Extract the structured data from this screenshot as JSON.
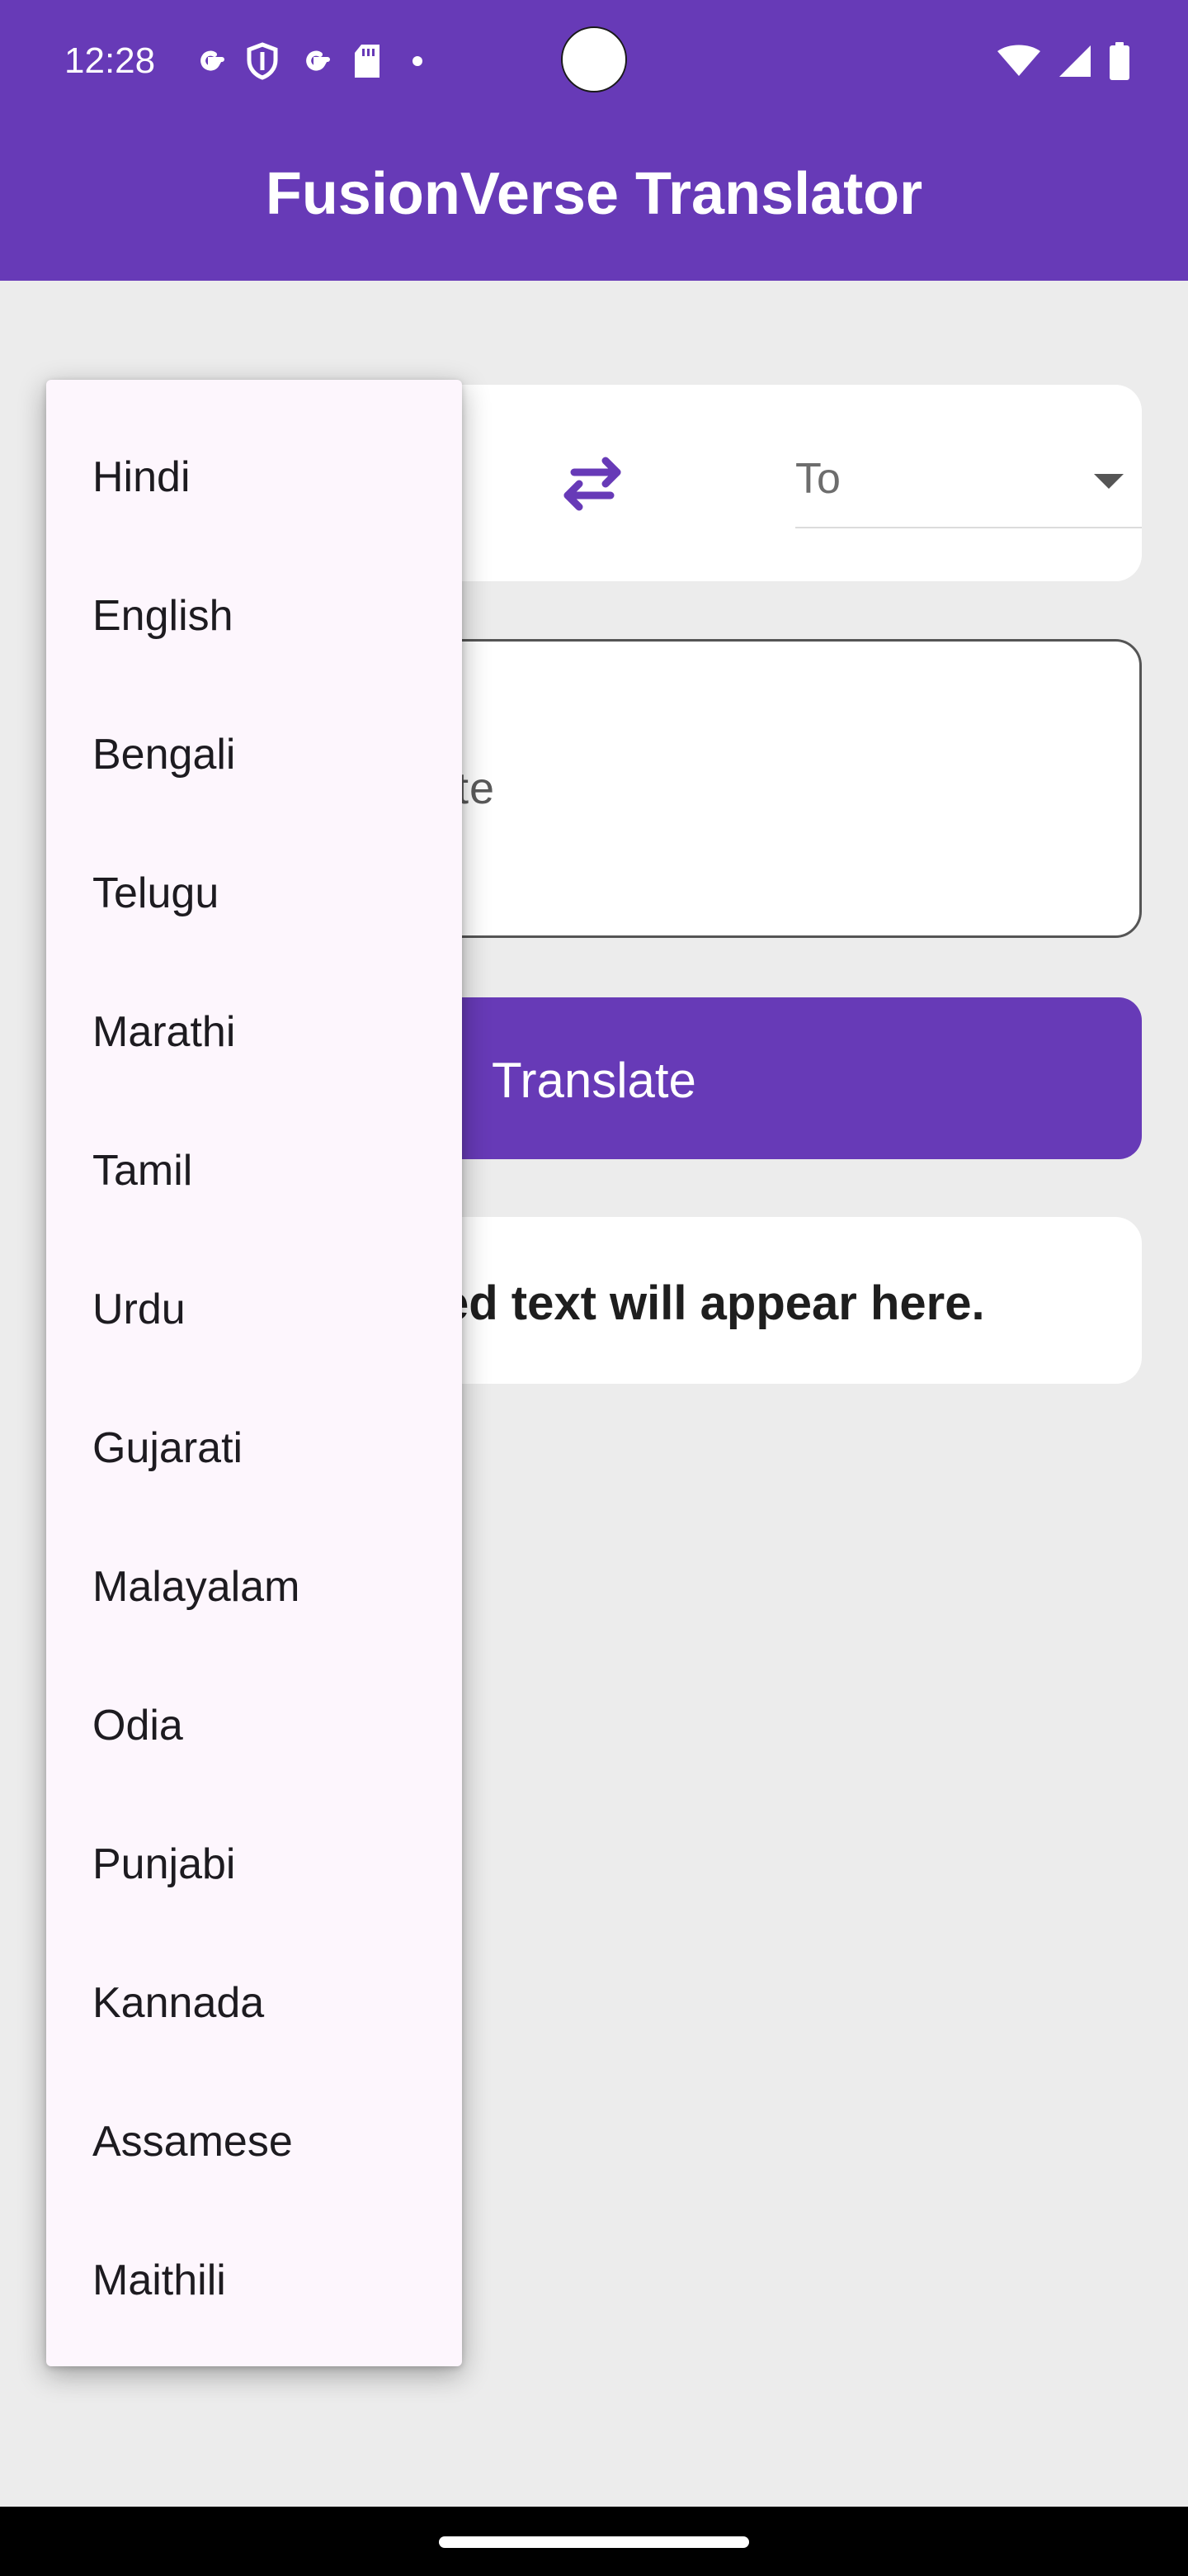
{
  "status_bar": {
    "time": "12:28",
    "left_icons": [
      "google-g-icon",
      "shield-icon",
      "google-g-icon",
      "sd-card-icon",
      "dot-icon"
    ],
    "right_icons": [
      "wifi-icon",
      "signal-icon",
      "battery-icon"
    ]
  },
  "app_bar": {
    "title": "FusionVerse Translator"
  },
  "language_selector": {
    "swap_icon": "swap-arrows-icon",
    "to_label": "To"
  },
  "input": {
    "placeholder_visible": "slate"
  },
  "translate_button": {
    "label": "Translate"
  },
  "output": {
    "visible_text": "ed text will appear here."
  },
  "dropdown": {
    "items": [
      "Hindi",
      "English",
      "Bengali",
      "Telugu",
      "Marathi",
      "Tamil",
      "Urdu",
      "Gujarati",
      "Malayalam",
      "Odia",
      "Punjabi",
      "Kannada",
      "Assamese",
      "Maithili"
    ]
  },
  "colors": {
    "primary": "#673ab7",
    "background": "#ececec",
    "menu_surface": "#fdf6fd",
    "card": "#ffffff"
  }
}
